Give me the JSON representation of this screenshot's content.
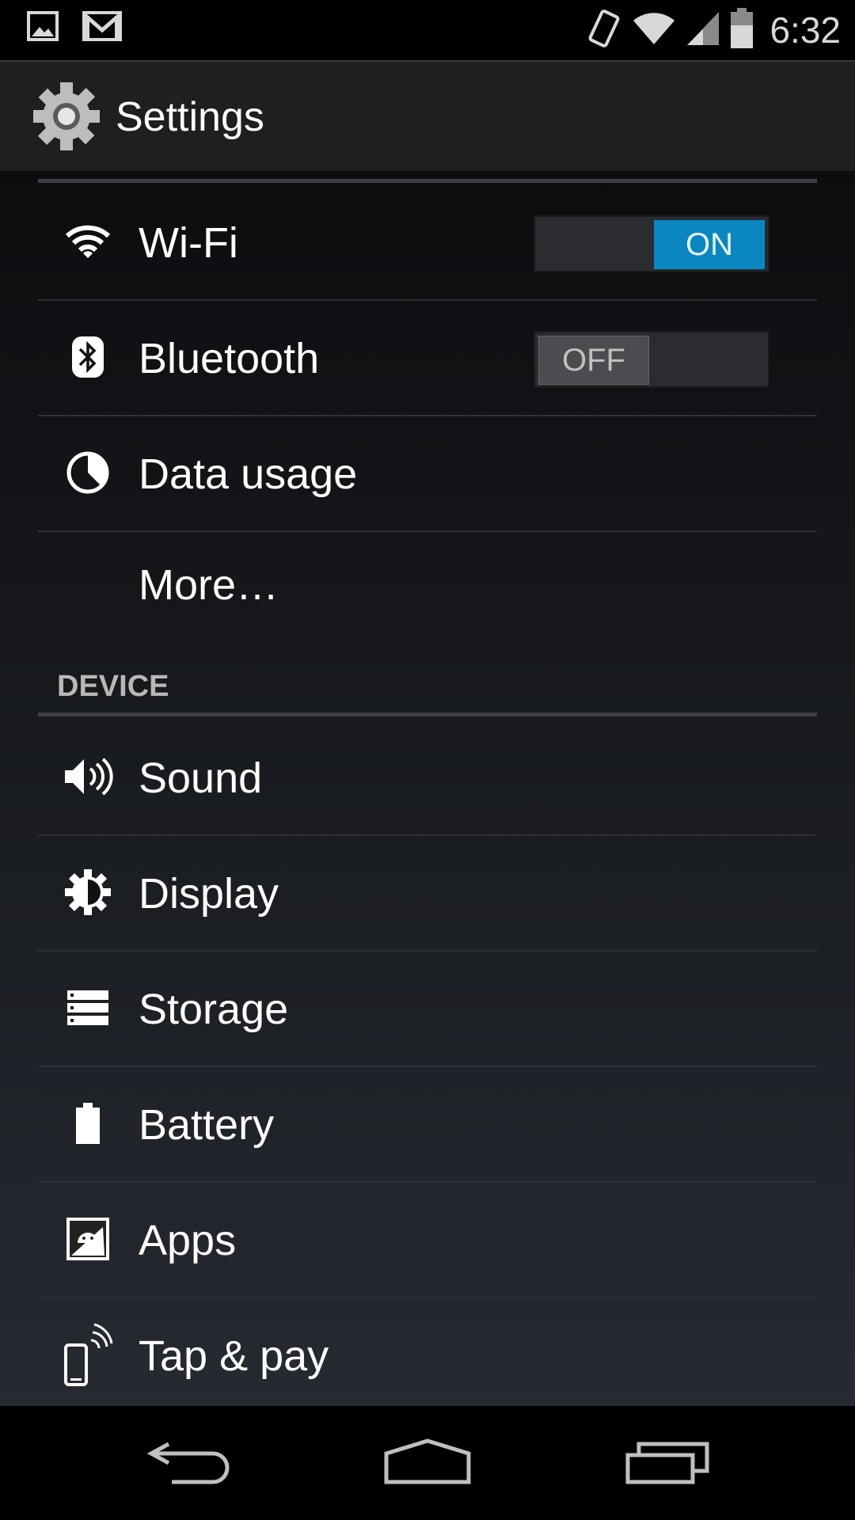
{
  "status_bar": {
    "time": "6:32",
    "icons": [
      "image-notification-icon",
      "gmail-icon",
      "vibrate-icon",
      "wifi-signal-icon",
      "cell-signal-icon",
      "battery-icon"
    ]
  },
  "action_bar": {
    "title": "Settings",
    "icon": "settings-gear-icon"
  },
  "wireless_items": [
    {
      "label": "Wi-Fi",
      "icon": "wifi-icon",
      "toggle": "ON"
    },
    {
      "label": "Bluetooth",
      "icon": "bluetooth-icon",
      "toggle": "OFF"
    },
    {
      "label": "Data usage",
      "icon": "data-usage-icon"
    },
    {
      "label": "More…"
    }
  ],
  "device_section": {
    "header": "DEVICE",
    "items": [
      {
        "label": "Sound",
        "icon": "sound-icon"
      },
      {
        "label": "Display",
        "icon": "display-brightness-icon"
      },
      {
        "label": "Storage",
        "icon": "storage-icon"
      },
      {
        "label": "Battery",
        "icon": "battery-icon"
      },
      {
        "label": "Apps",
        "icon": "apps-android-icon"
      },
      {
        "label": "Tap & pay",
        "icon": "tap-pay-icon"
      }
    ]
  },
  "nav_bar": {
    "buttons": [
      "back-icon",
      "home-icon",
      "recents-icon"
    ]
  },
  "colors": {
    "toggle_on": "#0a86c0",
    "toggle_off": "#4a4c50",
    "section_header": "#b8b8b8"
  }
}
